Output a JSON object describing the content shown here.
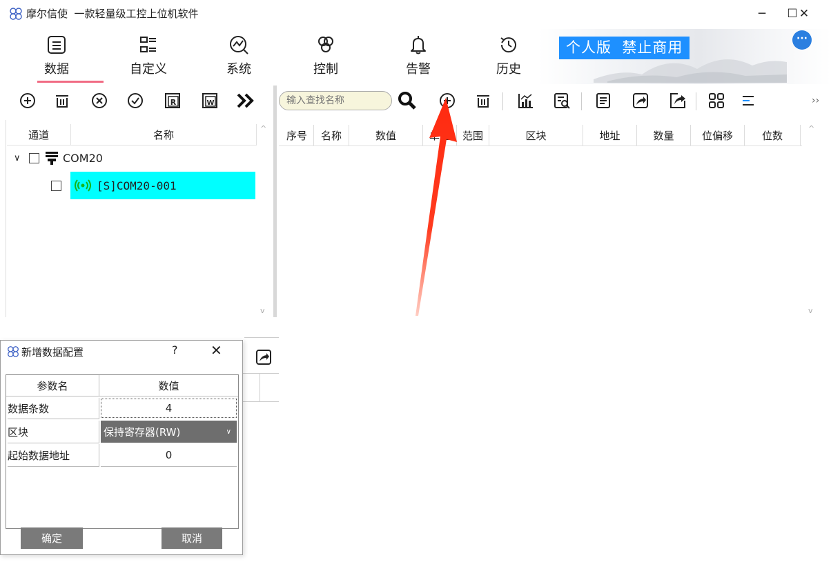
{
  "window": {
    "title": "摩尔信使  一款轻量级工控上位机软件",
    "controls": [
      "─",
      "☐",
      "✕"
    ]
  },
  "ribbon": {
    "tabs": [
      {
        "label": "数据",
        "icon": "list-icon",
        "active": true
      },
      {
        "label": "自定义",
        "icon": "custom-list-icon"
      },
      {
        "label": "系统",
        "icon": "system-chart-icon"
      },
      {
        "label": "控制",
        "icon": "control-icon"
      },
      {
        "label": "告警",
        "icon": "bell-icon"
      },
      {
        "label": "历史",
        "icon": "history-icon"
      }
    ],
    "badge": "个人版  禁止商用",
    "more": "···",
    "accent_color": "#f06b83",
    "badge_color": "#1e90ff"
  },
  "left_toolbar": {
    "buttons": [
      "add-icon",
      "delete-icon",
      "close-circle-icon",
      "check-circle-icon",
      "read-icon",
      "write-icon",
      "expand-icon"
    ],
    "read_letter": "R",
    "write_letter": "W"
  },
  "right_toolbar": {
    "search_placeholder": "输入查找名称",
    "buttons": [
      "search-icon",
      "add-icon",
      "delete-icon",
      "chart-icon",
      "inspect-icon",
      "document-icon",
      "import-icon",
      "export-icon",
      "grid-icon",
      "align-icon"
    ],
    "overflow": "››"
  },
  "tree": {
    "columns": [
      "通道",
      "名称"
    ],
    "channel": {
      "label": "COM20",
      "expander": "∨"
    },
    "device": {
      "label": "[S]COM20-001",
      "highlight_color": "#00ffff"
    }
  },
  "grid": {
    "columns": [
      "序号",
      "名称",
      "数值",
      "单位",
      "范围",
      "区块",
      "地址",
      "数量",
      "位偏移",
      "位数"
    ]
  },
  "dialog": {
    "title": "新增数据配置",
    "help": "?",
    "close": "✕",
    "headers": [
      "参数名",
      "数值"
    ],
    "rows": [
      {
        "name": "数据条数",
        "value": "4"
      },
      {
        "name": "区块",
        "value": "保持寄存器(RW)",
        "type": "select"
      },
      {
        "name": "起始数据地址",
        "value": "0"
      }
    ],
    "ok_label": "确定",
    "cancel_label": "取消"
  }
}
